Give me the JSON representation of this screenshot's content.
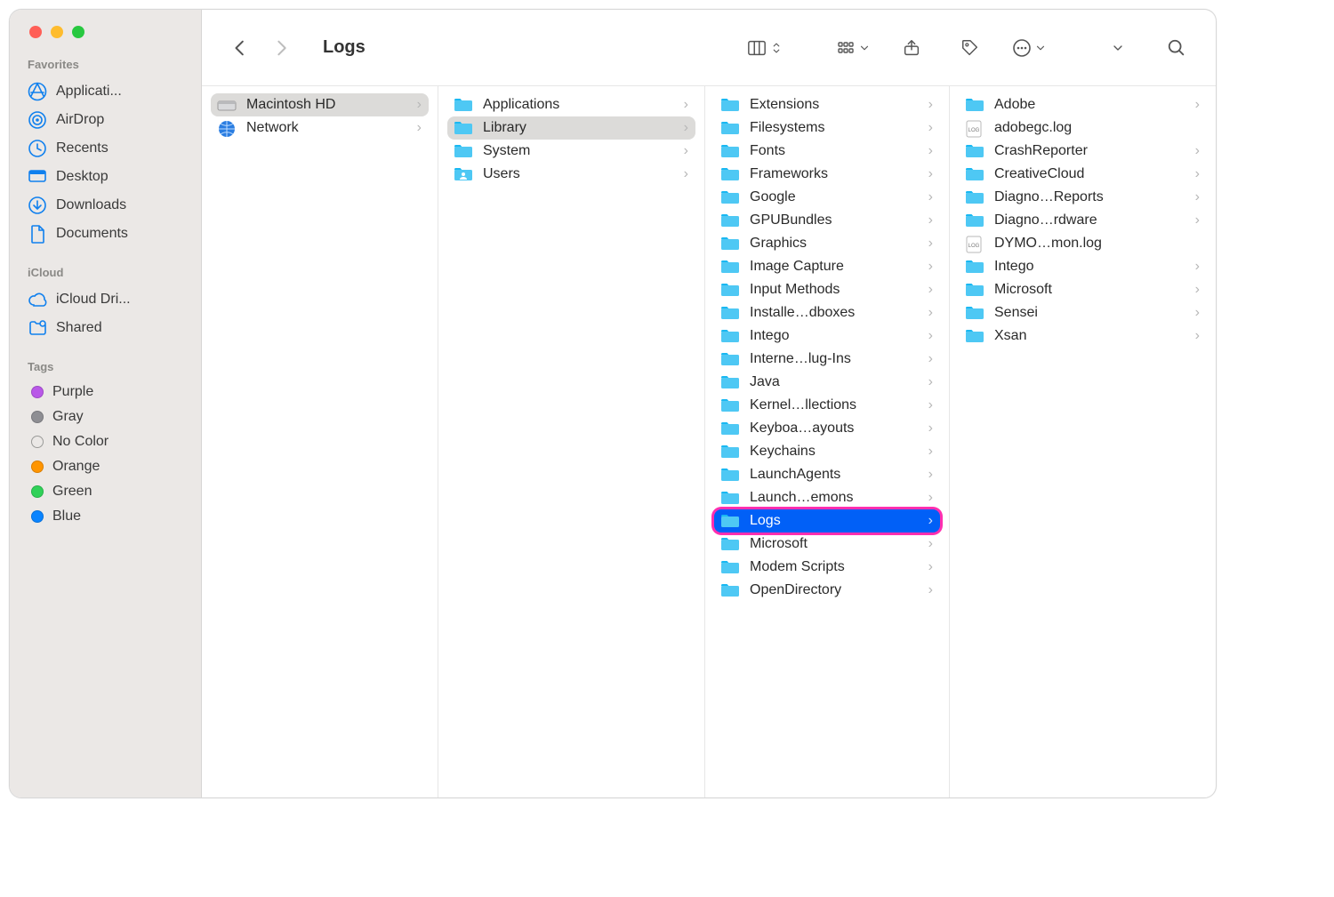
{
  "window_title": "Logs",
  "sidebar": {
    "sections": [
      {
        "header": "Favorites",
        "items": [
          {
            "icon": "appstore",
            "label": "Applicati..."
          },
          {
            "icon": "airdrop",
            "label": "AirDrop"
          },
          {
            "icon": "recents",
            "label": "Recents"
          },
          {
            "icon": "desktop",
            "label": "Desktop"
          },
          {
            "icon": "download",
            "label": "Downloads"
          },
          {
            "icon": "document",
            "label": "Documents"
          }
        ]
      },
      {
        "header": "iCloud",
        "items": [
          {
            "icon": "cloud",
            "label": "iCloud Dri..."
          },
          {
            "icon": "shared",
            "label": "Shared"
          }
        ]
      },
      {
        "header": "Tags",
        "items": [
          {
            "icon": "tag",
            "label": "Purple",
            "color": "#b958e8"
          },
          {
            "icon": "tag",
            "label": "Gray",
            "color": "#8e8e93"
          },
          {
            "icon": "tag",
            "label": "No Color",
            "color": "hollow"
          },
          {
            "icon": "tag",
            "label": "Orange",
            "color": "#ff9500"
          },
          {
            "icon": "tag",
            "label": "Green",
            "color": "#30d158"
          },
          {
            "icon": "tag",
            "label": "Blue",
            "color": "#0a84ff"
          }
        ]
      }
    ]
  },
  "toolbar": {
    "back_enabled": true,
    "forward_enabled": false
  },
  "columns": [
    {
      "items": [
        {
          "type": "drive",
          "label": "Macintosh HD",
          "has_children": true,
          "selected": "gray"
        },
        {
          "type": "network",
          "label": "Network",
          "has_children": true
        }
      ]
    },
    {
      "items": [
        {
          "type": "folder",
          "label": "Applications",
          "has_children": true
        },
        {
          "type": "folder",
          "label": "Library",
          "has_children": true,
          "selected": "gray"
        },
        {
          "type": "folder",
          "label": "System",
          "has_children": true
        },
        {
          "type": "folder",
          "label": "Users",
          "has_children": true,
          "variant": "users"
        }
      ]
    },
    {
      "items": [
        {
          "type": "folder",
          "label": "Extensions",
          "has_children": true
        },
        {
          "type": "folder",
          "label": "Filesystems",
          "has_children": true
        },
        {
          "type": "folder",
          "label": "Fonts",
          "has_children": true
        },
        {
          "type": "folder",
          "label": "Frameworks",
          "has_children": true
        },
        {
          "type": "folder",
          "label": "Google",
          "has_children": true
        },
        {
          "type": "folder",
          "label": "GPUBundles",
          "has_children": true
        },
        {
          "type": "folder",
          "label": "Graphics",
          "has_children": true
        },
        {
          "type": "folder",
          "label": "Image Capture",
          "has_children": true
        },
        {
          "type": "folder",
          "label": "Input Methods",
          "has_children": true
        },
        {
          "type": "folder",
          "label": "Installe…dboxes",
          "has_children": true
        },
        {
          "type": "folder",
          "label": "Intego",
          "has_children": true
        },
        {
          "type": "folder",
          "label": "Interne…lug-Ins",
          "has_children": true
        },
        {
          "type": "folder",
          "label": "Java",
          "has_children": true
        },
        {
          "type": "folder",
          "label": "Kernel…llections",
          "has_children": true
        },
        {
          "type": "folder",
          "label": "Keyboa…ayouts",
          "has_children": true
        },
        {
          "type": "folder",
          "label": "Keychains",
          "has_children": true
        },
        {
          "type": "folder",
          "label": "LaunchAgents",
          "has_children": true
        },
        {
          "type": "folder",
          "label": "Launch…emons",
          "has_children": true
        },
        {
          "type": "folder",
          "label": "Logs",
          "has_children": true,
          "selected": "blue",
          "highlight": true
        },
        {
          "type": "folder",
          "label": "Microsoft",
          "has_children": true
        },
        {
          "type": "folder",
          "label": "Modem Scripts",
          "has_children": true
        },
        {
          "type": "folder",
          "label": "OpenDirectory",
          "has_children": true
        }
      ]
    },
    {
      "items": [
        {
          "type": "folder",
          "label": "Adobe",
          "has_children": true
        },
        {
          "type": "logfile",
          "label": "adobegc.log",
          "has_children": false
        },
        {
          "type": "folder",
          "label": "CrashReporter",
          "has_children": true
        },
        {
          "type": "folder",
          "label": "CreativeCloud",
          "has_children": true
        },
        {
          "type": "folder",
          "label": "Diagno…Reports",
          "has_children": true
        },
        {
          "type": "folder",
          "label": "Diagno…rdware",
          "has_children": true
        },
        {
          "type": "logfile",
          "label": "DYMO…mon.log",
          "has_children": false
        },
        {
          "type": "folder",
          "label": "Intego",
          "has_children": true
        },
        {
          "type": "folder",
          "label": "Microsoft",
          "has_children": true
        },
        {
          "type": "folder",
          "label": "Sensei",
          "has_children": true
        },
        {
          "type": "folder",
          "label": "Xsan",
          "has_children": true
        }
      ]
    }
  ]
}
